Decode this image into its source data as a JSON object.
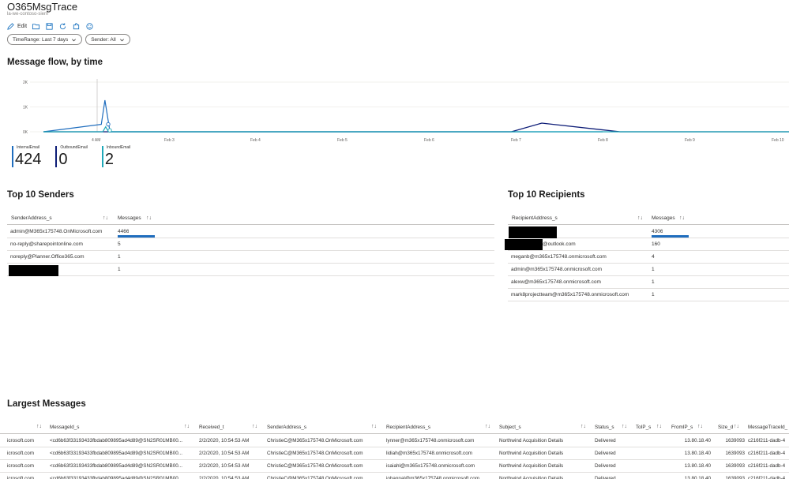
{
  "header": {
    "title": "O365MsgTrace",
    "subtitle": "la-we-contoso-siem"
  },
  "toolbar": {
    "edit_label": "Edit"
  },
  "params": {
    "time_range": "TimeRange: Last 7 days",
    "sender": "Sender: All"
  },
  "flow": {
    "title": "Message flow, by time",
    "chart_data": {
      "type": "line",
      "y_ticks": [
        "2K",
        "1K",
        "0K"
      ],
      "ylim": [
        0,
        2000
      ],
      "x_tick_labels": [
        "4 AM",
        "Feb 3",
        "Feb 4",
        "Feb 5",
        "Feb 6",
        "Feb 7",
        "Feb 8",
        "Feb 9",
        "Feb 10"
      ],
      "series": [
        {
          "name": "InternalEmail",
          "color": "#1f6dbe",
          "points": [
            [
              0.0,
              0
            ],
            [
              0.8,
              300
            ],
            [
              0.85,
              1270
            ],
            [
              0.92,
              0
            ],
            [
              6.0,
              0
            ]
          ]
        },
        {
          "name": "OutboundEmail",
          "color": "#0d1c77",
          "points": [
            [
              0.0,
              0
            ],
            [
              4.95,
              0
            ],
            [
              5.3,
              350
            ],
            [
              6.2,
              0
            ],
            [
              8.5,
              0
            ]
          ]
        },
        {
          "name": "InboundEmail",
          "color": "#1ea8b9",
          "points": [
            [
              0.0,
              0
            ],
            [
              0.82,
              0
            ],
            [
              0.86,
              200
            ],
            [
              0.9,
              0
            ],
            [
              8.5,
              0
            ]
          ]
        }
      ]
    }
  },
  "kpis": [
    {
      "label": "InternalEmail",
      "value": "424",
      "color": "#1f6dbe"
    },
    {
      "label": "OutboundEmail",
      "value": "0",
      "color": "#0d1c77"
    },
    {
      "label": "InboundEmail",
      "value": "2",
      "color": "#1ea8b9"
    }
  ],
  "senders": {
    "title": "Top 10 Senders",
    "col1": "SenderAddress_s",
    "col2": "Messages",
    "rows": [
      {
        "addr": "admin@M365x175748.OnMicrosoft.com",
        "count": "4466",
        "frac": 1.0
      },
      {
        "addr": "no-reply@sharepointonline.com",
        "count": "5",
        "frac": 0
      },
      {
        "addr": "noreply@Planner.Office365.com",
        "count": "1",
        "frac": 0
      },
      {
        "addr": "",
        "count": "1",
        "frac": 0
      }
    ]
  },
  "recipients": {
    "title": "Top 10 Recipients",
    "col1": "RecipientAddress_s",
    "col2": "Messages",
    "rows": [
      {
        "addr": "",
        "count": "4306",
        "frac": 1.0
      },
      {
        "addr": "@outlook.com",
        "count": "160",
        "frac": 0
      },
      {
        "addr": "meganb@m365x175748.onmicrosoft.com",
        "count": "4",
        "frac": 0
      },
      {
        "addr": "admin@m365x175748.onmicrosoft.com",
        "count": "1",
        "frac": 0
      },
      {
        "addr": "alexw@m365x175748.onmicrosoft.com",
        "count": "1",
        "frac": 0
      },
      {
        "addr": "mark8projectteam@m365x175748.onmicrosoft.com",
        "count": "1",
        "frac": 0
      }
    ]
  },
  "largest": {
    "title": "Largest Messages",
    "headers": [
      "MessageId_s",
      "Received_t",
      "SenderAddress_s",
      "RecipientAddress_s",
      "Subject_s",
      "Status_s",
      "ToIP_s",
      "FromIP_s",
      "Size_d",
      "MessageTraceId_"
    ],
    "rows": [
      [
        "icrosoft.com",
        "<cd6b63f33193433fbdab809895ad4d89@SN2SR01MB00...",
        "2/2/2020, 10:54:53 AM",
        "ChristieC@M365x175748.OnMicrosoft.com",
        "lynner@m365x175748.onmicrosoft.com",
        "Northwind Acquisition Details",
        "Delivered",
        "",
        "13.80.18.40",
        "1639093",
        "c216f211-dadb-4"
      ],
      [
        "icrosoft.com",
        "<cd6b63f33193433fbdab809895ad4d89@SN2SR01MB00...",
        "2/2/2020, 10:54:53 AM",
        "ChristieC@M365x175748.OnMicrosoft.com",
        "lidiah@m365x175748.onmicrosoft.com",
        "Northwind Acquisition Details",
        "Delivered",
        "",
        "13.80.18.40",
        "1639093",
        "c216f211-dadb-4"
      ],
      [
        "icrosoft.com",
        "<cd6b63f33193433fbdab809895ad4d89@SN2SR01MB00...",
        "2/2/2020, 10:54:53 AM",
        "ChristieC@M365x175748.OnMicrosoft.com",
        "isaiahl@m365x175748.onmicrosoft.com",
        "Northwind Acquisition Details",
        "Delivered",
        "",
        "13.80.18.40",
        "1639093",
        "c216f211-dadb-4"
      ],
      [
        "icrosoft.com",
        "<cd6b63f33193433fbdab809895ad4d89@SN2SR01MB00...",
        "2/2/2020, 10:54:53 AM",
        "ChristieC@M365x175748.OnMicrosoft.com",
        "johannal@m365x175748.onmicrosoft.com",
        "Northwind Acquisition Details",
        "Delivered",
        "",
        "13.80.18.40",
        "1639093",
        "c216f211-dadb-4"
      ]
    ]
  }
}
